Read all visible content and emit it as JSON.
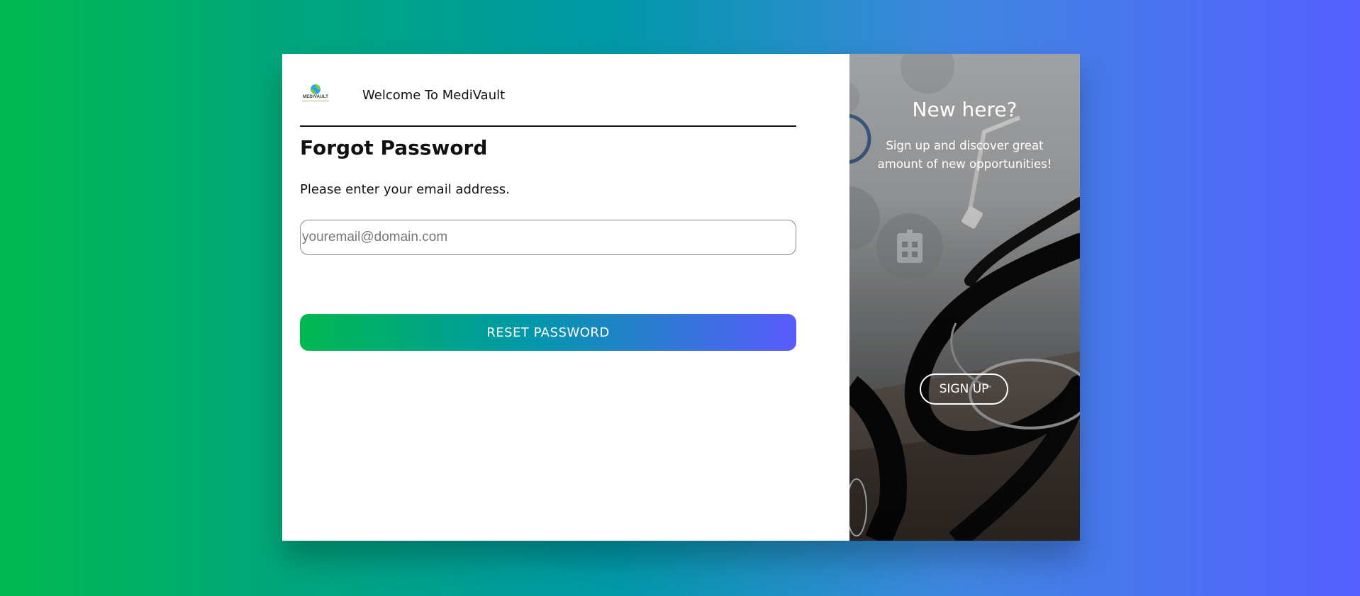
{
  "brand": {
    "logo_text": "MEDIVAULT",
    "welcome": "Welcome To MediVault"
  },
  "form": {
    "title": "Forgot Password",
    "instruction": "Please enter your email address.",
    "email_placeholder": "youremail@domain.com",
    "email_value": "",
    "reset_label": "RESET PASSWORD"
  },
  "signup_panel": {
    "heading": "New here?",
    "text": "Sign up and discover great amount of new opportunities!",
    "button_label": "SIGN UP"
  },
  "colors": {
    "gradient_start": "#00b84f",
    "gradient_mid": "#0099a8",
    "gradient_end": "#5560ff"
  },
  "icons": [
    "medivault-logo",
    "hospital-icon",
    "stethoscope-illustration"
  ]
}
